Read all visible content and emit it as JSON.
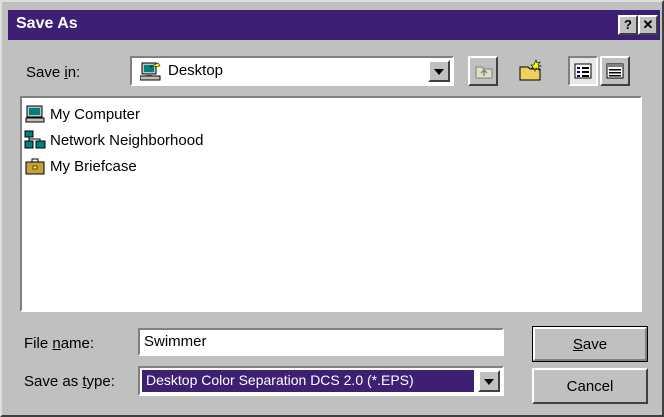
{
  "window": {
    "title": "Save As",
    "help_label": "?",
    "close_label": "✕"
  },
  "save_in": {
    "label_pre": "Save ",
    "label_accel": "i",
    "label_post": "n:",
    "value": "Desktop"
  },
  "files": [
    {
      "name": "My Computer",
      "icon": "computer-icon"
    },
    {
      "name": "Network Neighborhood",
      "icon": "network-icon"
    },
    {
      "name": "My Briefcase",
      "icon": "briefcase-icon"
    }
  ],
  "file_name": {
    "label_pre": "File ",
    "label_accel": "n",
    "label_post": "ame:",
    "value": "Swimmer"
  },
  "save_type": {
    "label_pre": "Save as ",
    "label_accel": "t",
    "label_post": "ype:",
    "value": "Desktop Color Separation DCS 2.0 (*.EPS)"
  },
  "buttons": {
    "save_accel": "S",
    "save_rest": "ave",
    "cancel": "Cancel"
  },
  "colors": {
    "title_bar": "#3d1f74",
    "selection": "#3d1f74",
    "face": "#c0c0c0"
  }
}
